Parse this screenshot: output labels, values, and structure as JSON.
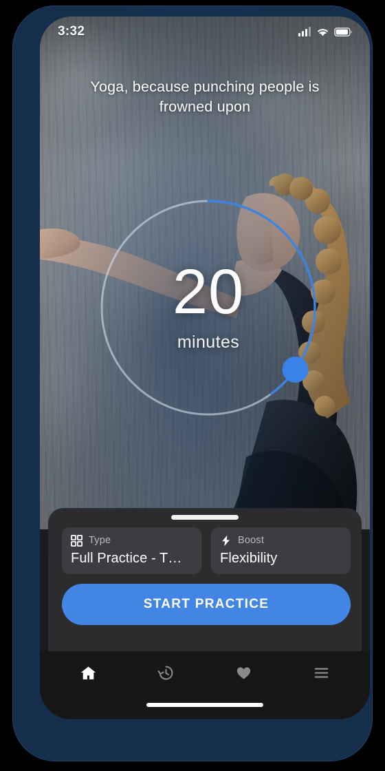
{
  "statusbar": {
    "time": "3:32",
    "icons": [
      "signal-icon",
      "wifi-icon",
      "battery-icon"
    ]
  },
  "hero": {
    "headline": "Yoga, because punching people is frowned upon"
  },
  "dial": {
    "value": "20",
    "unit": "minutes",
    "progress_percent": 40,
    "track_color": "#c9d6e6",
    "progress_color": "#3f83e0",
    "handle_color": "#3b82e8"
  },
  "sheet": {
    "cards": [
      {
        "icon": "grid-icon",
        "label": "Type",
        "value": "Full Practice - T…"
      },
      {
        "icon": "bolt-icon",
        "label": "Boost",
        "value": "Flexibility"
      }
    ],
    "cta_label": "START PRACTICE"
  },
  "nav": {
    "items": [
      {
        "icon": "home-icon",
        "name": "nav-home",
        "active": true
      },
      {
        "icon": "history-icon",
        "name": "nav-history",
        "active": false
      },
      {
        "icon": "heart-icon",
        "name": "nav-favorites",
        "active": false
      },
      {
        "icon": "menu-icon",
        "name": "nav-menu",
        "active": false
      }
    ],
    "active_color": "#ffffff",
    "inactive_color": "#8a8a8d"
  }
}
